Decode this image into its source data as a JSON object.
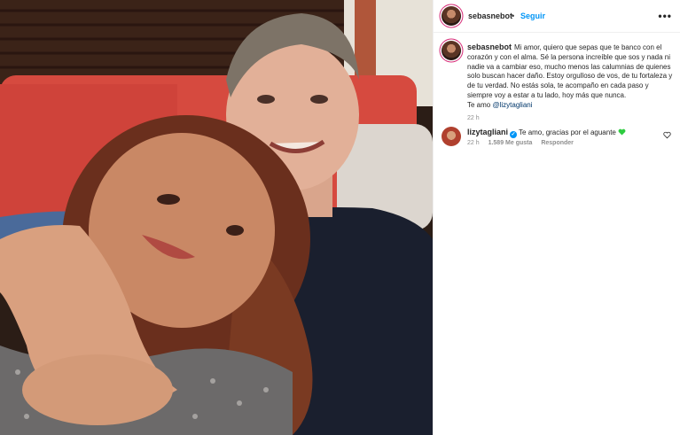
{
  "post": {
    "author": "sebasnebot",
    "follow_label": "Seguir",
    "more_icon": "more-options-icon",
    "caption_text": "Mi amor, quiero que sepas que te banco con el corazón y con el alma. Sé la persona increíble que sos y nada ni nadie va a cambiar eso, mucho menos las calumnias de quienes solo buscan hacer daño. Estoy orgulloso de vos, de tu fortaleza y de tu verdad. No estás sola, te acompaño en cada paso y siempre voy a estar a tu lado, hoy más que nunca.",
    "caption_sign": "Te amo",
    "caption_mention": "@lizytagliani",
    "caption_time": "22 h"
  },
  "comment": {
    "author": "lizytagliani",
    "text": "Te amo, gracias por el aguante",
    "time": "22 h",
    "likes": "1.589 Me gusta",
    "reply_label": "Responder",
    "verified_icon": "verified-badge-icon",
    "emoji": "green-heart-icon",
    "like_icon": "heart-outline-icon"
  },
  "colors": {
    "link_blue": "#0095f6",
    "mention": "#00376b",
    "muted": "#8e8e8e",
    "green_heart": "#2ecc40"
  }
}
